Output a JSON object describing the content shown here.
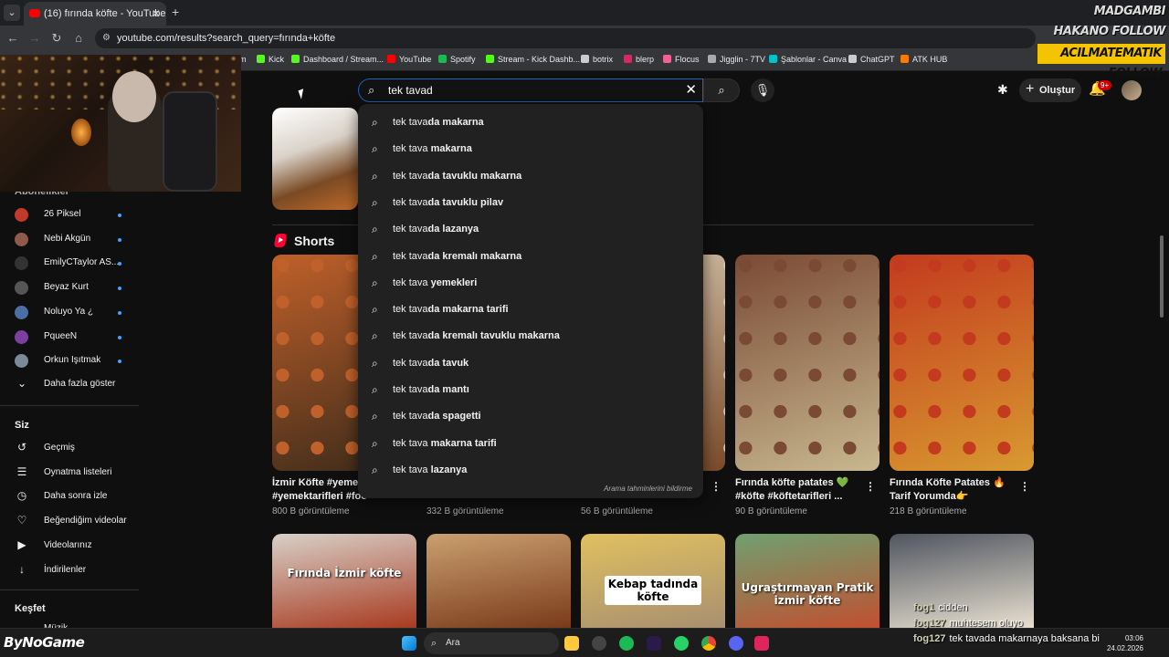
{
  "browser": {
    "tab_title": "(16) fırında köfte - YouTube",
    "url": "youtube.com/results?search_query=fırında+köfte",
    "bookmarks": [
      {
        "label": "m",
        "color": "#888888"
      },
      {
        "label": "Kick",
        "color": "#53fc18"
      },
      {
        "label": "Dashboard / Stream...",
        "color": "#53fc18"
      },
      {
        "label": "YouTube",
        "color": "#ff0000"
      },
      {
        "label": "Spotify",
        "color": "#1db954"
      },
      {
        "label": "Stream - Kick Dashb...",
        "color": "#53fc18"
      },
      {
        "label": "botrix",
        "color": "#cccccc"
      },
      {
        "label": "blerp",
        "color": "#e0245e"
      },
      {
        "label": "Flocus",
        "color": "#f06292"
      },
      {
        "label": "Jigglin - 7TV",
        "color": "#aaaaaa"
      },
      {
        "label": "Şablonlar - Canva",
        "color": "#00c4cc"
      },
      {
        "label": "ChatGPT",
        "color": "#cccccc"
      },
      {
        "label": "ATK HUB",
        "color": "#ff7a00"
      }
    ]
  },
  "overlay": {
    "follows": [
      "MADGAMBI FOLLOW",
      "HAKANO FOLLOW",
      "ACILMATEMATIK FOLLOW"
    ],
    "brand": "ByNoGame",
    "chat": [
      {
        "user": "fog1",
        "msg": "cidden"
      },
      {
        "user": "fog127",
        "msg": "muhtesem oluyo"
      },
      {
        "user": "fog127",
        "msg": "tek tavada makarnaya baksana bi"
      }
    ]
  },
  "search": {
    "query": "tek tavad",
    "suggestions": [
      {
        "prefix": "tek tava",
        "rest": "da makarna"
      },
      {
        "prefix": "tek tava",
        "rest": " makarna"
      },
      {
        "prefix": "tek tava",
        "rest": "da tavuklu makarna"
      },
      {
        "prefix": "tek tava",
        "rest": "da tavuklu pilav"
      },
      {
        "prefix": "tek tava",
        "rest": "da lazanya"
      },
      {
        "prefix": "tek tava",
        "rest": "da kremalı makarna"
      },
      {
        "prefix": "tek tava",
        "rest": " yemekleri"
      },
      {
        "prefix": "tek tava",
        "rest": "da makarna tarifi"
      },
      {
        "prefix": "tek tava",
        "rest": "da kremalı tavuklu makarna"
      },
      {
        "prefix": "tek tava",
        "rest": "da tavuk"
      },
      {
        "prefix": "tek tava",
        "rest": "da mantı"
      },
      {
        "prefix": "tek tava",
        "rest": "da spagetti"
      },
      {
        "prefix": "tek tava",
        "rest": " makarna tarifi"
      },
      {
        "prefix": "tek tava",
        "rest": " lazanya"
      }
    ],
    "report_label": "Arama tahminlerini bildirme"
  },
  "header": {
    "create_label": "Oluştur",
    "notif_badge": "9+"
  },
  "sidebar": {
    "subs_heading": "Abonelikler",
    "subs": [
      {
        "label": "26 Piksel",
        "color": "#c0392b"
      },
      {
        "label": "Nebi Akgün",
        "color": "#8e5a4a"
      },
      {
        "label": "EmilyCTaylor AS...",
        "color": "#333333"
      },
      {
        "label": "Beyaz Kurt",
        "color": "#555555"
      },
      {
        "label": "Noluyo Ya ¿",
        "color": "#4a6fa5"
      },
      {
        "label": "PqueeN",
        "color": "#7b3fa0"
      },
      {
        "label": "Orkun Işıtmak",
        "color": "#7a8a99"
      }
    ],
    "more_label": "Daha fazla göster",
    "you_heading": "Siz",
    "you_items": [
      {
        "label": "Geçmiş",
        "icon": "history-icon",
        "glyph": "↺"
      },
      {
        "label": "Oynatma listeleri",
        "icon": "playlist-icon",
        "glyph": "☰"
      },
      {
        "label": "Daha sonra izle",
        "icon": "clock-icon",
        "glyph": "◷"
      },
      {
        "label": "Beğendiğim videolar",
        "icon": "thumbs-up-icon",
        "glyph": "♡"
      },
      {
        "label": "Videolarınız",
        "icon": "video-icon",
        "glyph": "▶"
      },
      {
        "label": "İndirilenler",
        "icon": "download-icon",
        "glyph": "↓"
      }
    ],
    "explore_heading": "Keşfet",
    "explore_partial": "Müzik"
  },
  "main": {
    "shorts_heading": "Shorts",
    "shorts": [
      {
        "title1": "İzmir Köfte #yemek",
        "title2": "#yemektarifleri #foo",
        "views": "800 B görüntüleme",
        "c1": "#c0602a",
        "c2": "#3a2a1a"
      },
      {
        "title1": "",
        "title2": "",
        "views": "332 B görüntüleme",
        "c1": "#b85a30",
        "c2": "#402010"
      },
      {
        "title1": "",
        "title2": "",
        "views": "56 B görüntüleme",
        "c1": "#d8c8b0",
        "c2": "#7a4a2a"
      },
      {
        "title1": "Fırında köfte patates 💚",
        "title2": "#köfte #köftetarifleri ...",
        "views": "90 B görüntüleme",
        "c1": "#7a4a34",
        "c2": "#c8b890"
      },
      {
        "title1": "Fırında Köfte Patates 🔥",
        "title2": "Tarif Yorumda👉",
        "views": "218 B görüntüleme",
        "c1": "#c33a1e",
        "c2": "#d89a30"
      }
    ],
    "row2": [
      {
        "overlay": "Fırında İzmir köfte",
        "c1": "#d8d0c8",
        "c2": "#a83a20"
      },
      {
        "overlay": "",
        "c1": "#caa070",
        "c2": "#7a3a1a"
      },
      {
        "overlay": "Kebap tadında köfte",
        "c1": "#e0c060",
        "c2": "#a89070"
      },
      {
        "overlay": "Ugraştırmayan Pratik izmir köfte",
        "c1": "#70a070",
        "c2": "#c05030"
      },
      {
        "overlay": "",
        "c1": "#505560",
        "c2": "#e8e0d0"
      }
    ]
  },
  "taskbar": {
    "search_label": "Ara",
    "time": "03:06",
    "date": "24.02.2026"
  }
}
